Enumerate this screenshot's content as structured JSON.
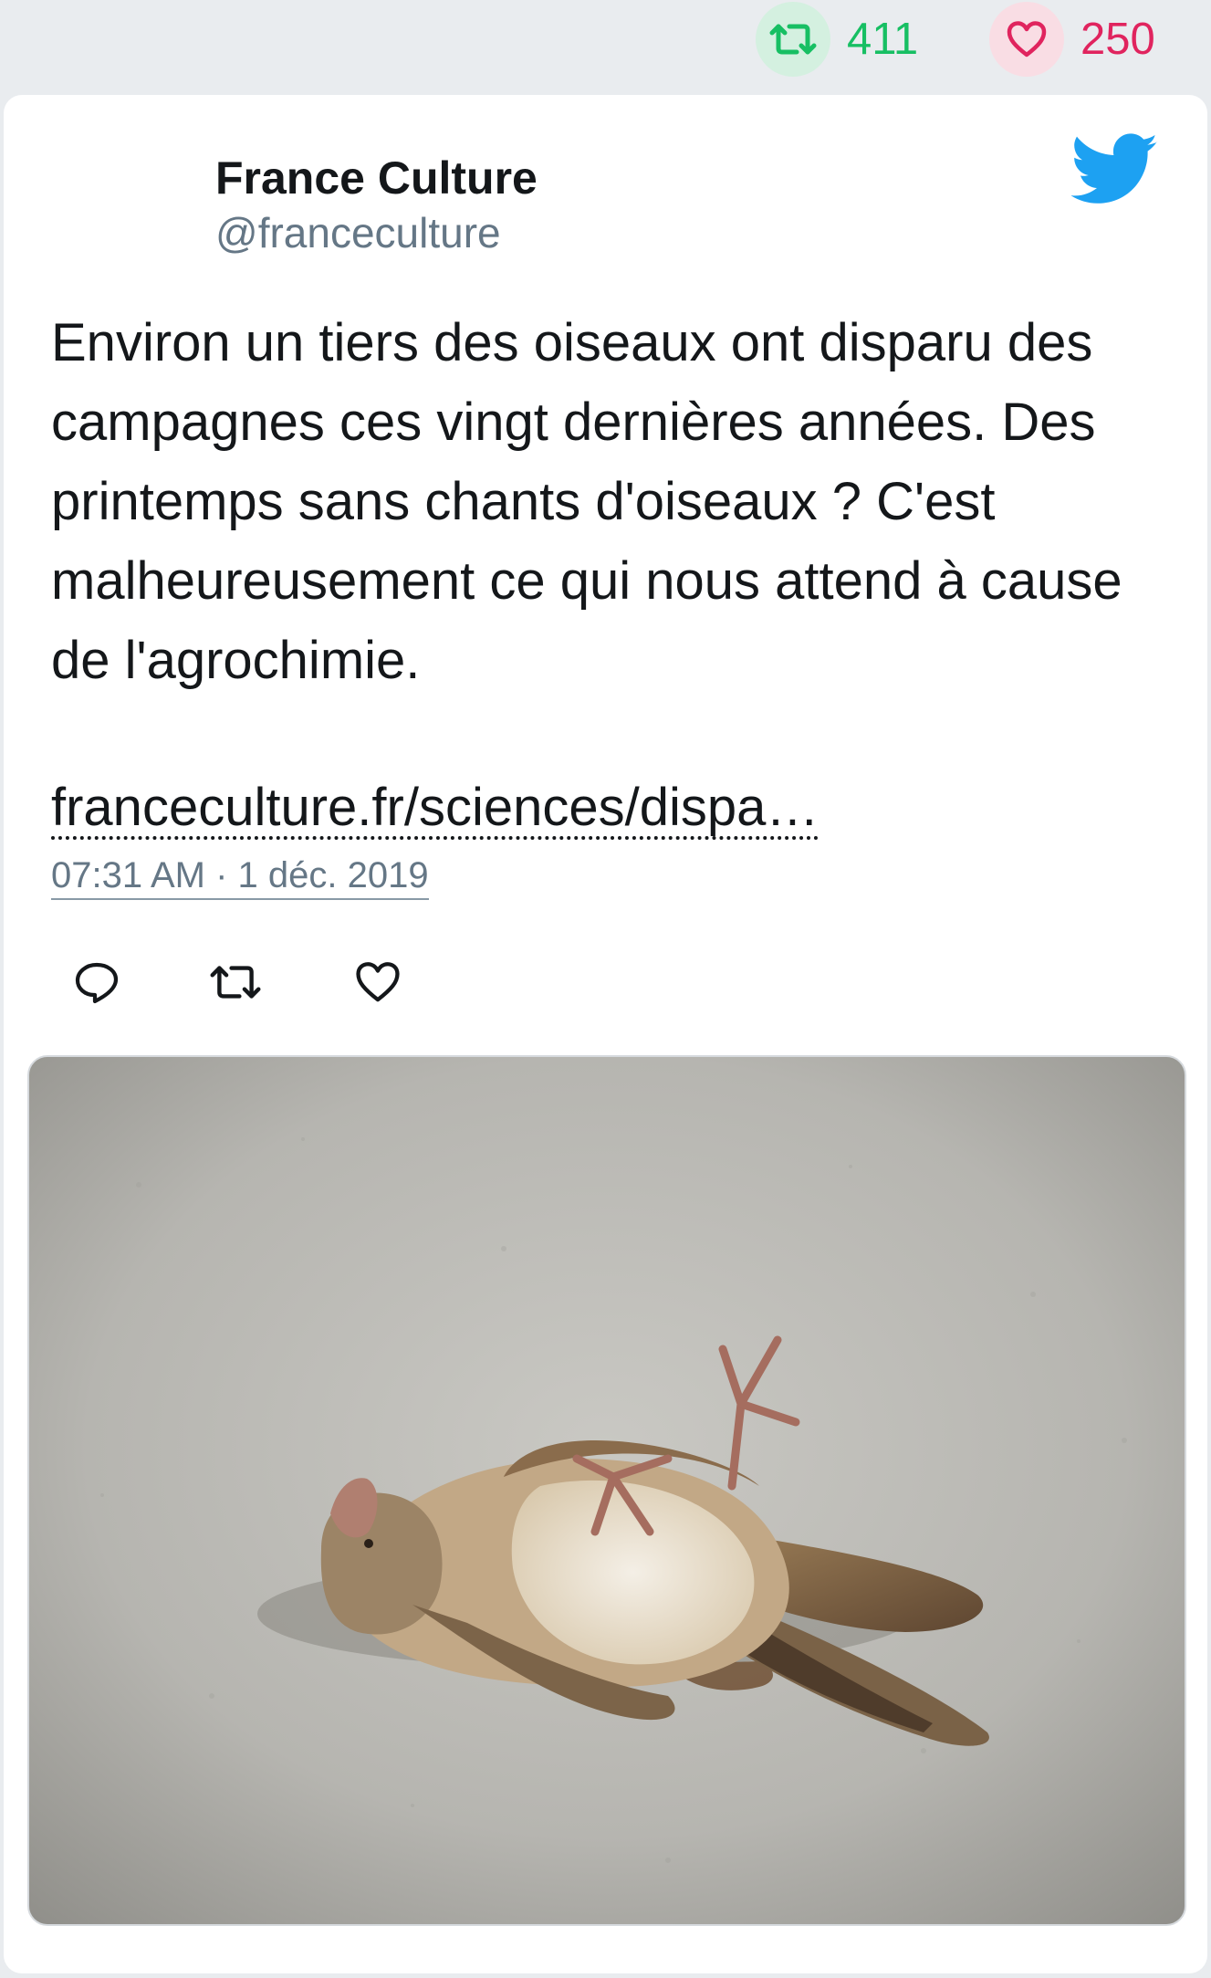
{
  "stats": {
    "retweets": "411",
    "likes": "250",
    "retweet_icon": "retweet-icon",
    "like_icon": "heart-icon"
  },
  "tweet": {
    "author_name": "France Culture",
    "author_handle": "@franceculture",
    "text": "Environ un tiers des oiseaux ont disparu des campagnes ces vingt dernières années. Des printemps sans chants d'oiseaux ? C'est malheureusement ce qui nous attend à cause de l'agrochimie.",
    "link": "franceculture.fr/sciences/dispa…",
    "timestamp": "07:31 AM · 1 déc. 2019",
    "platform_icon": "twitter-bird-icon"
  },
  "actions": {
    "reply_icon": "reply-icon",
    "retweet_icon": "retweet-icon",
    "like_icon": "heart-icon"
  },
  "colors": {
    "retweet": "#17bf63",
    "like": "#e0245e",
    "twitter_blue": "#1da1f2",
    "text": "#14171a",
    "muted": "#657786"
  }
}
